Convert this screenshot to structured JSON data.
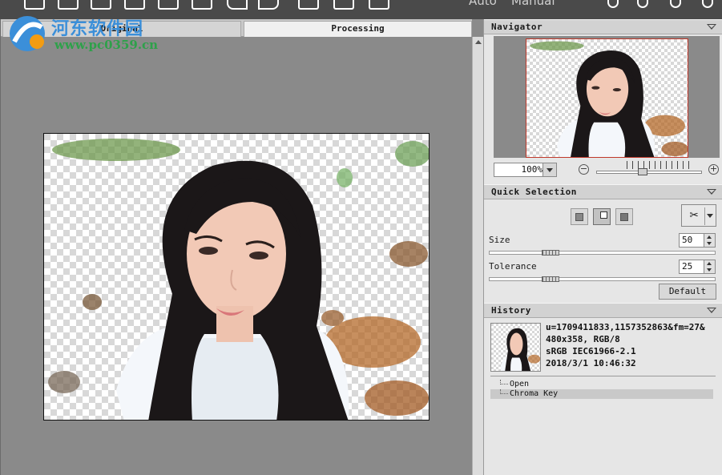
{
  "toolbar": {
    "mode_auto": "Auto",
    "mode_manual": "Manual"
  },
  "watermark": {
    "title": "河东软件园",
    "url": "www.pc0359.cn"
  },
  "tabs": {
    "original": "Original",
    "processing": "Processing"
  },
  "navigator": {
    "title": "Navigator",
    "zoom_value": "100%"
  },
  "quick_selection": {
    "title": "Quick Selection",
    "size_label": "Size",
    "size_value": "50",
    "size_slider_level": 0.27,
    "tolerance_label": "Tolerance",
    "tolerance_value": "25",
    "tolerance_slider_level": 0.27,
    "default_label": "Default"
  },
  "history": {
    "title": "History",
    "info_line1": "u=1709411833,1157352863&fm=27&",
    "info_line2": "480x358, RGB/8",
    "info_line3": "sRGB IEC61966-2.1",
    "info_line4": "2018/3/1 10:46:32",
    "items": [
      {
        "label": "Open"
      },
      {
        "label": "Chroma Key"
      }
    ]
  },
  "icons": [
    "open-icon",
    "save-icon",
    "print-icon",
    "web-icon",
    "images-icon",
    "settings-icon",
    "undo-icon",
    "redo-icon",
    "crop-icon",
    "mask-icon",
    "filter-icon",
    "help-icon",
    "info-icon",
    "gear-icon",
    "share-icon",
    "scroll-up-icon",
    "zoom-out-icon",
    "zoom-in-icon",
    "brush-icon",
    "dropdown-icon",
    "collapse-icon"
  ],
  "colors": {
    "watermark_blue": "#3b8fd9",
    "watermark_green": "#2ea14a",
    "navigator_frame": "#c0392b"
  }
}
